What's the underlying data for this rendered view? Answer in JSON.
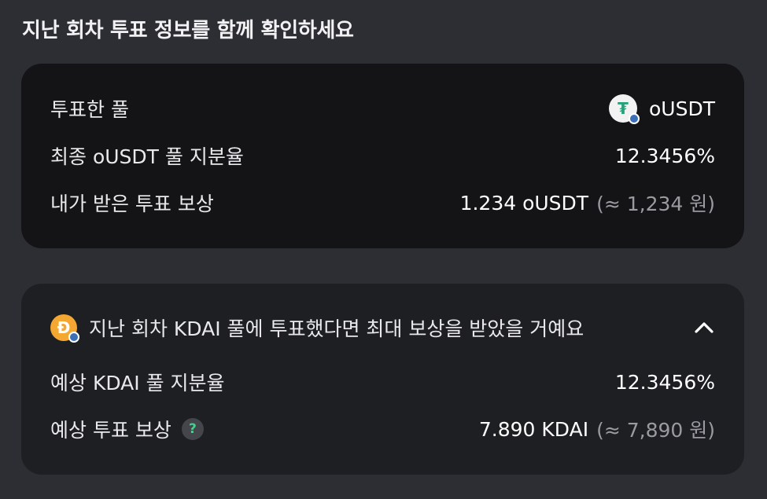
{
  "heading": "지난 회차 투표 정보를 함께 확인하세요",
  "summary": {
    "pool_label": "투표한 풀",
    "pool_token": "oUSDT",
    "pool_icon": "usdt-token-icon",
    "share_label": "최종 oUSDT 풀 지분율",
    "share_value": "12.3456%",
    "reward_label": "내가 받은 투표 보상",
    "reward_value": "1.234 oUSDT",
    "reward_krw": "(≈ 1,234 원)"
  },
  "alternative": {
    "title": "지난 회차 KDAI 풀에 투표했다면 최대 보상을 받았을 거예요",
    "token_icon": "kdai-token-icon",
    "expanded": true,
    "share_label": "예상 KDAI 풀 지분율",
    "share_value": "12.3456%",
    "reward_label": "예상 투표 보상",
    "help_glyph": "?",
    "reward_value": "7.890 KDAI",
    "reward_krw": "(≈ 7,890 원)"
  },
  "colors": {
    "background": "#2d2e33",
    "card_primary": "#141417",
    "card_secondary": "#1e1f23",
    "usdt_green": "#26a17b",
    "kdai_orange": "#f4a832",
    "help_green": "#43d18c",
    "muted_text": "#9a9aa0"
  }
}
